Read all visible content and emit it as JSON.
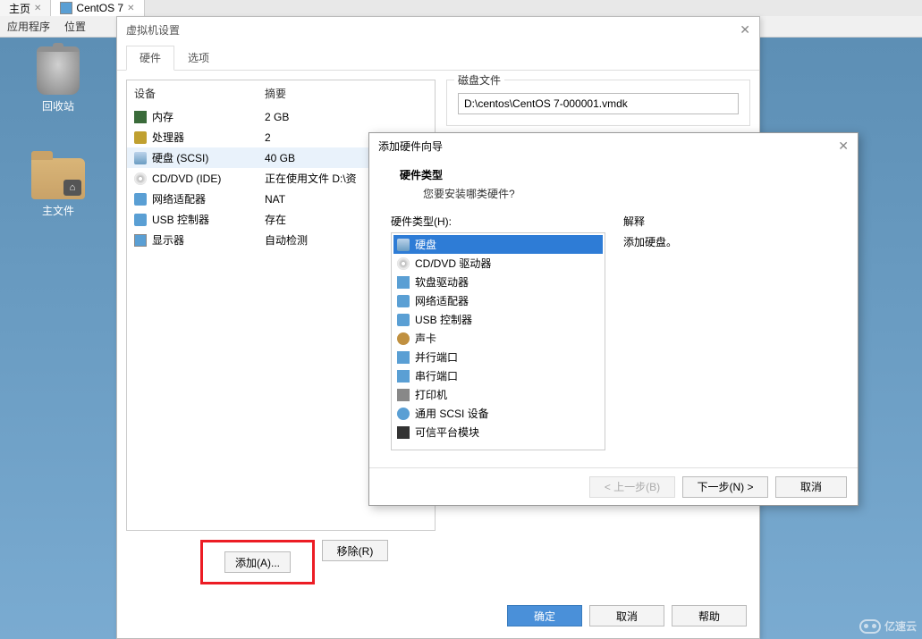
{
  "tabs": {
    "home": "主页",
    "centos": "CentOS 7"
  },
  "menubar": {
    "apps": "应用程序",
    "location": "位置"
  },
  "desktop": {
    "trash": "回收站",
    "homefolder": "主文件"
  },
  "settings": {
    "title": "虚拟机设置",
    "tab_hw": "硬件",
    "tab_opt": "选项",
    "col_device": "设备",
    "col_summary": "摘要",
    "rows": [
      {
        "name": "内存",
        "summary": "2 GB",
        "icon": "ic-mem"
      },
      {
        "name": "处理器",
        "summary": "2",
        "icon": "ic-cpu"
      },
      {
        "name": "硬盘 (SCSI)",
        "summary": "40 GB",
        "icon": "ic-disk"
      },
      {
        "name": "CD/DVD (IDE)",
        "summary": "正在使用文件 D:\\资",
        "icon": "ic-cd"
      },
      {
        "name": "网络适配器",
        "summary": "NAT",
        "icon": "ic-net"
      },
      {
        "name": "USB 控制器",
        "summary": "存在",
        "icon": "ic-usb"
      },
      {
        "name": "显示器",
        "summary": "自动检测",
        "icon": "ic-disp"
      }
    ],
    "selected_row": 2,
    "add_btn": "添加(A)...",
    "remove_btn": "移除(R)",
    "diskfile_group": "磁盘文件",
    "diskfile_path": "D:\\centos\\CentOS 7-000001.vmdk",
    "ok": "确定",
    "cancel": "取消",
    "help": "帮助"
  },
  "wizard": {
    "title": "添加硬件向导",
    "heading": "硬件类型",
    "sub": "您要安装哪类硬件?",
    "list_label": "硬件类型(H):",
    "desc_label": "解释",
    "desc_text": "添加硬盘。",
    "types": [
      {
        "name": "硬盘",
        "icon": "ic-disk"
      },
      {
        "name": "CD/DVD 驱动器",
        "icon": "ic-cd"
      },
      {
        "name": "软盘驱动器",
        "icon": "ic-floppy"
      },
      {
        "name": "网络适配器",
        "icon": "ic-net"
      },
      {
        "name": "USB 控制器",
        "icon": "ic-usb"
      },
      {
        "name": "声卡",
        "icon": "ic-sound"
      },
      {
        "name": "并行端口",
        "icon": "ic-par"
      },
      {
        "name": "串行端口",
        "icon": "ic-ser"
      },
      {
        "name": "打印机",
        "icon": "ic-prn"
      },
      {
        "name": "通用 SCSI 设备",
        "icon": "ic-scsi"
      },
      {
        "name": "可信平台模块",
        "icon": "ic-tpm"
      }
    ],
    "selected_type": 0,
    "back": "< 上一步(B)",
    "next": "下一步(N) >",
    "cancel": "取消"
  },
  "watermark": "亿速云"
}
